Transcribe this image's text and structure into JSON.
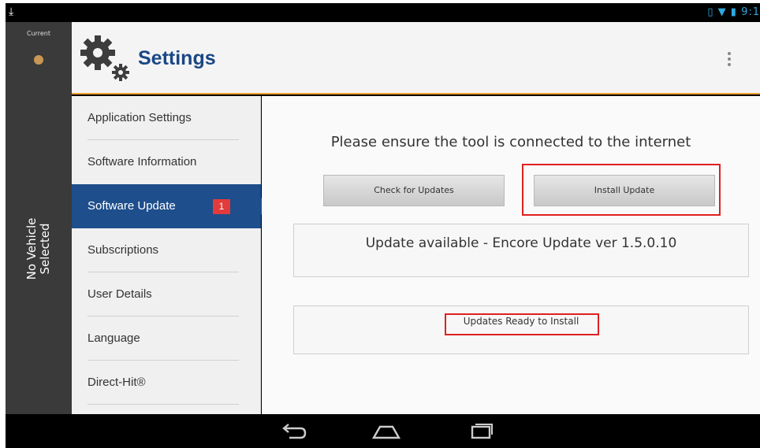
{
  "status_bar": {
    "time": "9:1"
  },
  "rail": {
    "current_label": "Current",
    "vehicle_label_1": "No Vehicle",
    "vehicle_label_2": "Selected"
  },
  "header": {
    "title": "Settings",
    "icons": {
      "settings": "gear-icon",
      "menu": "overflow-menu-icon"
    }
  },
  "sidebar": {
    "items": [
      {
        "label": "Application Settings"
      },
      {
        "label": "Software Information"
      },
      {
        "label": "Software Update",
        "badge": "1",
        "active": true
      },
      {
        "label": "Subscriptions"
      },
      {
        "label": "User Details"
      },
      {
        "label": "Language"
      },
      {
        "label": "Direct-Hit®"
      }
    ]
  },
  "main": {
    "notice": "Please ensure the tool is connected to the internet",
    "check_button": "Check for Updates",
    "install_button": "Install Update",
    "update_status": "Update available - Encore Update ver 1.5.0.10",
    "ready_status": "Updates Ready to Install"
  },
  "colors": {
    "accent": "#1e4e8c",
    "title": "#1a4785",
    "badge": "#e33b3b",
    "highlight": "#e02020",
    "header_rule": "#f0a030"
  }
}
